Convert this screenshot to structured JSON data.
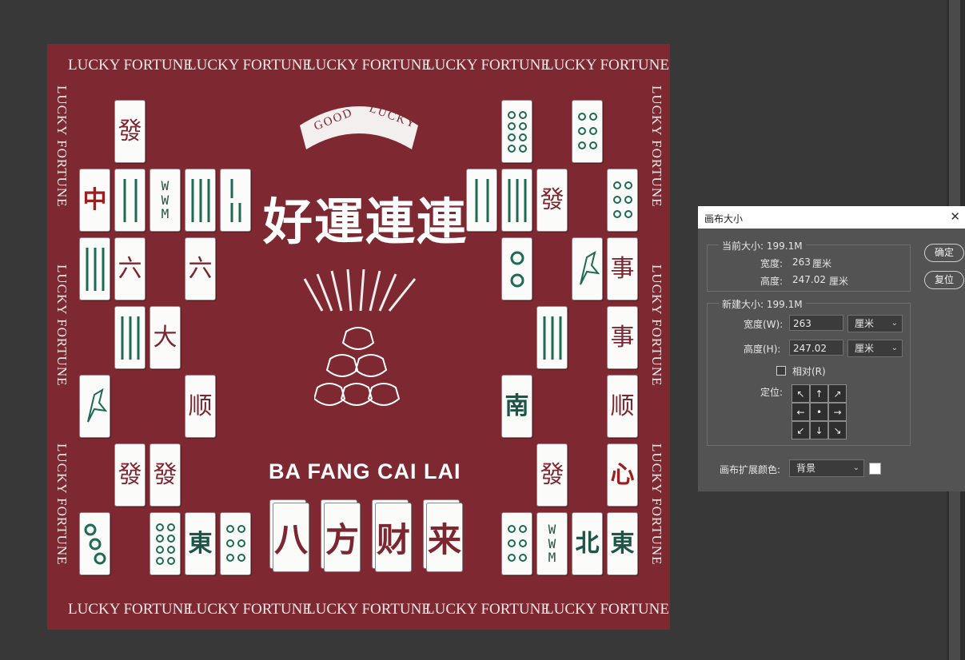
{
  "canvas": {
    "border_text": "LUCKY FORTUNE",
    "good_lucky": {
      "left": "GOOD",
      "right": "LUCKY"
    },
    "motto": "好運連連",
    "bafang_caption": "BA FANG CAI LAI",
    "big_tiles": [
      "八",
      "方",
      "财",
      "来"
    ],
    "tiles": [
      "發",
      "中",
      "六",
      "六",
      "大",
      "顺",
      "發",
      "發",
      "東",
      "發",
      "南",
      "事",
      "事",
      "顺",
      "心",
      "發",
      "北",
      "東"
    ]
  },
  "dialog": {
    "title": "画布大小",
    "close_icon": "close-icon",
    "current_size": {
      "legend": "当前大小: 199.1M",
      "width_label": "宽度:",
      "width_value": "263",
      "width_unit": "厘米",
      "height_label": "高度:",
      "height_value": "247.02",
      "height_unit": "厘米"
    },
    "new_size": {
      "legend": "新建大小: 199.1M",
      "width_label": "宽度(W):",
      "width_value": "263",
      "width_unit": "厘米",
      "height_label": "高度(H):",
      "height_value": "247.02",
      "height_unit": "厘米",
      "relative_label": "相对(R)",
      "relative_checked": false,
      "anchor_label": "定位:",
      "anchor_arrows": [
        "↖",
        "↑",
        "↗",
        "←",
        "•",
        "→",
        "↙",
        "↓",
        "↘"
      ]
    },
    "extension_color_label": "画布扩展颜色:",
    "extension_color_value": "背景",
    "ok_label": "确定",
    "reset_label": "复位"
  }
}
